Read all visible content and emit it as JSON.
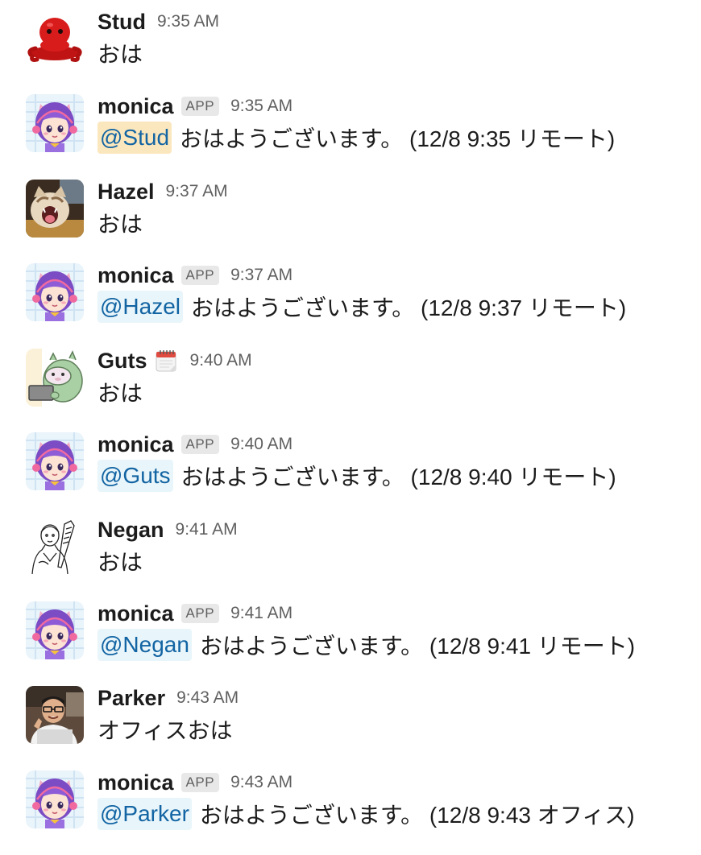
{
  "messages": [
    {
      "sender": "Stud",
      "time": "9:35 AM",
      "text": "おは",
      "avatar": "red-octopus-avatar"
    },
    {
      "sender": "monica",
      "badge": "APP",
      "time": "9:35 AM",
      "mention": "@Stud",
      "text": "おはようございます。 (12/8 9:35 リモート)",
      "avatar": "anime-girl-avatar"
    },
    {
      "sender": "Hazel",
      "time": "9:37 AM",
      "text": "おは",
      "avatar": "yawning-cat-avatar"
    },
    {
      "sender": "monica",
      "badge": "APP",
      "time": "9:37 AM",
      "mention": "@Hazel",
      "text": "おはようございます。 (12/8 9:37 リモート)",
      "avatar": "anime-girl-avatar"
    },
    {
      "sender": "Guts",
      "status_emoji": "calendar-icon",
      "time": "9:40 AM",
      "text": "おは",
      "avatar": "green-creature-laptop-avatar"
    },
    {
      "sender": "monica",
      "badge": "APP",
      "time": "9:40 AM",
      "mention": "@Guts",
      "text": "おはようございます。 (12/8 9:40 リモート)",
      "avatar": "anime-girl-avatar"
    },
    {
      "sender": "Negan",
      "time": "9:41 AM",
      "text": "おは",
      "avatar": "sketch-man-bat-avatar"
    },
    {
      "sender": "monica",
      "badge": "APP",
      "time": "9:41 AM",
      "mention": "@Negan",
      "text": "おはようございます。 (12/8 9:41 リモート)",
      "avatar": "anime-girl-avatar"
    },
    {
      "sender": "Parker",
      "time": "9:43 AM",
      "text": "オフィスおは",
      "avatar": "photo-man-glasses-avatar"
    },
    {
      "sender": "monica",
      "badge": "APP",
      "time": "9:43 AM",
      "mention": "@Parker",
      "text": "おはようございます。 (12/8 9:43 オフィス)",
      "avatar": "anime-girl-avatar"
    }
  ],
  "colors": {
    "mention_bg": "#e8f5fa",
    "mention_self_bg": "#fbe7bd",
    "mention_text": "#1264a3",
    "timestamp": "#616061",
    "badge_bg": "#e8e8e8"
  }
}
